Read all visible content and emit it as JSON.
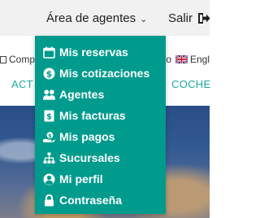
{
  "header": {
    "agents_menu_label": "Área de agentes",
    "logout_label": "Salir"
  },
  "subbar": {
    "item_left": "Comp",
    "item_mid": "to",
    "language_label": "Engl"
  },
  "nav": {
    "item_left": "ACT",
    "item_right": "COCHE"
  },
  "dropdown": {
    "items": [
      {
        "label": "Mis reservas",
        "icon": "calendar-icon"
      },
      {
        "label": "Mis cotizaciones",
        "icon": "dollar-circle-icon"
      },
      {
        "label": "Agentes",
        "icon": "users-icon"
      },
      {
        "label": "Mis facturas",
        "icon": "invoice-icon"
      },
      {
        "label": "Mis pagos",
        "icon": "hand-coin-icon"
      },
      {
        "label": "Sucursales",
        "icon": "sitemap-icon"
      },
      {
        "label": "Mi perfil",
        "icon": "user-circle-icon"
      },
      {
        "label": "Contraseña",
        "icon": "lock-icon"
      }
    ]
  },
  "colors": {
    "dropdown_bg": "#009b8d",
    "nav_accent": "#1ba7a0",
    "topbar_bg": "#f1f1f1"
  }
}
